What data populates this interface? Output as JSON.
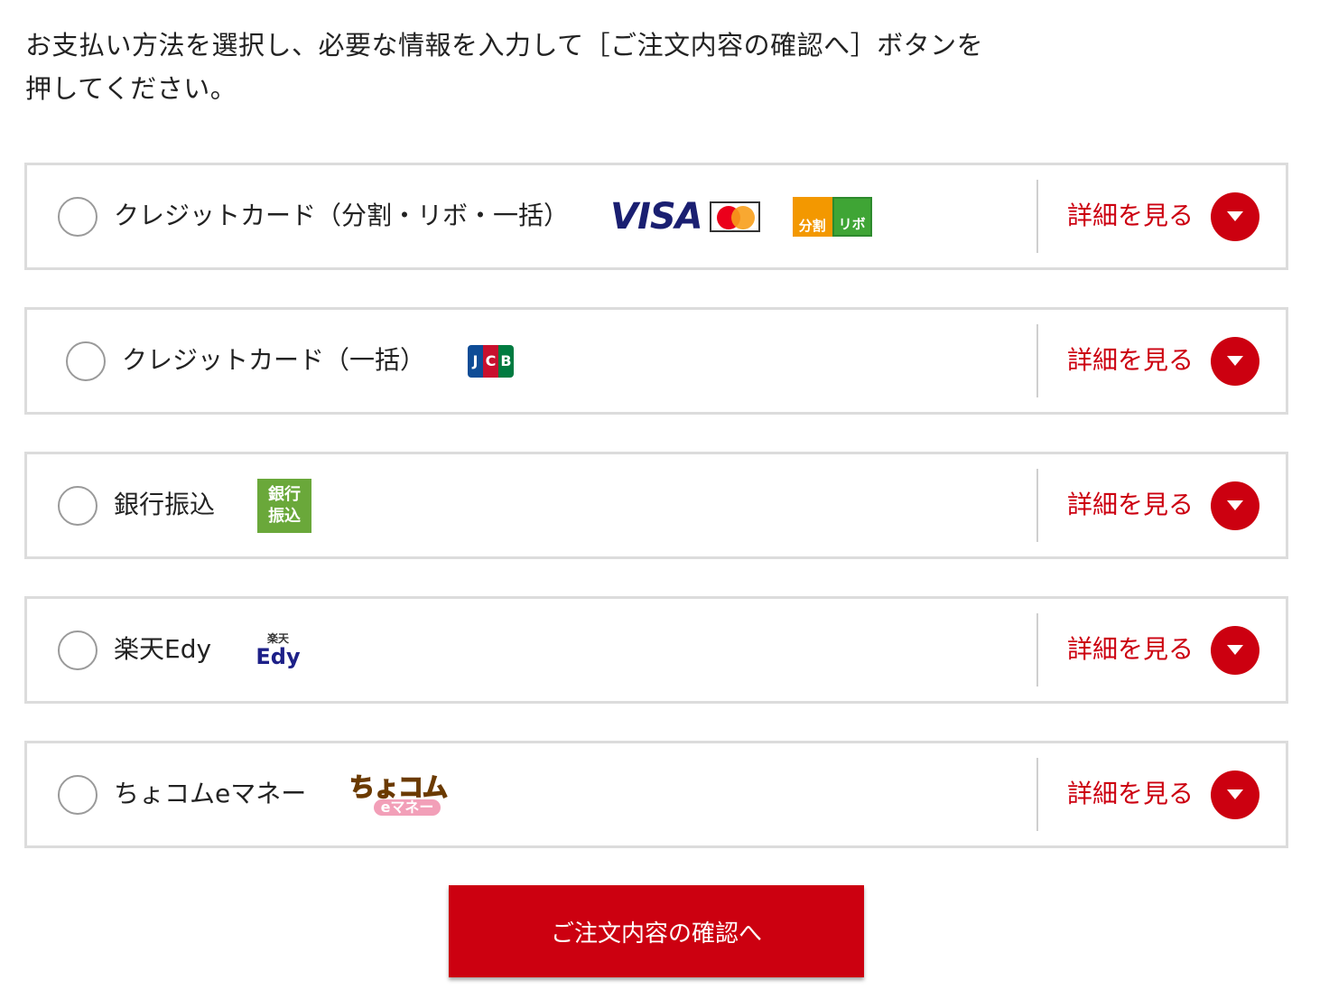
{
  "intro": {
    "line1": "お支払い方法を選択し、必要な情報を入力して［ご注文内容の確認へ］ボタンを",
    "line2": "押してください。"
  },
  "options": [
    {
      "label": "クレジットカード（分割・リボ・一括）",
      "logos": [
        "VISA",
        "MasterCard",
        "分割",
        "リボ"
      ],
      "detail_label": "詳細を見る"
    },
    {
      "label": "クレジットカード（一括）",
      "logos": [
        "JCB"
      ],
      "detail_label": "詳細を見る"
    },
    {
      "label": "銀行振込",
      "logos": [
        "銀行",
        "振込"
      ],
      "detail_label": "詳細を見る"
    },
    {
      "label": "楽天Edy",
      "logos": [
        "楽天",
        "Edy"
      ],
      "detail_label": "詳細を見る"
    },
    {
      "label": "ちょコムeマネー",
      "logos": [
        "ちょコム",
        "eマネー"
      ],
      "detail_label": "詳細を見る"
    }
  ],
  "submit_label": "ご注文内容の確認へ",
  "colors": {
    "accent": "#cc0010",
    "border": "#dcdcdc"
  },
  "icons": {
    "radio": "radio-unchecked-icon",
    "toggle": "chevron-down-icon"
  }
}
